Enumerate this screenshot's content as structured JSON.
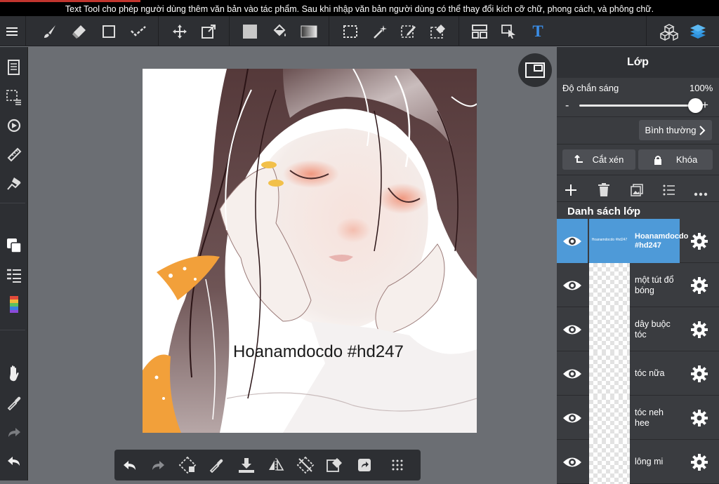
{
  "tooltip": {
    "text": "Text Tool cho phép người dùng thêm văn bản vào tác phẩm. Sau khi nhập văn bản người dùng có thể thay đổi kích cỡ chữ, phong cách, và phông chữ."
  },
  "toolbar": {
    "icons": [
      "menu-icon",
      "brush-icon",
      "eraser-icon",
      "shape-icon",
      "lasso-fill-icon",
      "move-icon",
      "transform-icon",
      "fill-color-icon",
      "bucket-icon",
      "gradient-icon",
      "selection-icon",
      "magic-wand-icon",
      "select-pen-icon",
      "select-eraser-icon",
      "frame-divider-icon",
      "operation-icon",
      "text-tool-icon",
      "material-icon",
      "layers-icon"
    ],
    "text_tool_glyph": "T"
  },
  "canvas": {
    "artwork_text": "Hoanamdocdo #hd247"
  },
  "layer_panel": {
    "title": "Lớp",
    "opacity_label": "Độ chắn sáng",
    "opacity_value": "100%",
    "opacity_fraction": 1.0,
    "minus": "-",
    "plus": "+",
    "blend_mode": "Bình thường",
    "clip_label": "Cắt xén",
    "lock_label": "Khóa",
    "list_title": "Danh sách lớp",
    "layers": [
      {
        "name": "Hoanamdocdo #hd247",
        "thumb_text": "Hoanamdocdo #hd247",
        "selected": true
      },
      {
        "name": "một tút đổ bóng",
        "selected": false
      },
      {
        "name": "dây buộc tóc",
        "selected": false
      },
      {
        "name": "tóc nữa",
        "selected": false
      },
      {
        "name": "tóc neh hee",
        "selected": false
      },
      {
        "name": "lông mi",
        "selected": false
      }
    ]
  },
  "colors": {
    "accent": "#4e9ad8",
    "toolbar_bg": "#2d2f33",
    "canvas_bg": "#6b6e73",
    "text_tool_blue": "#3a8ee8",
    "hair": "#3c2527",
    "ribbon": "#f2a03a"
  }
}
